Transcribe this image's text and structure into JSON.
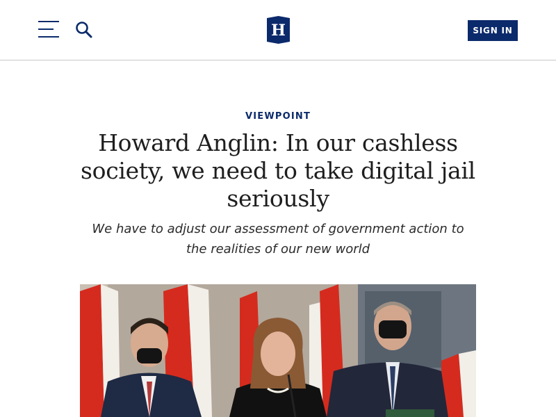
{
  "header": {
    "menu_icon": "hamburger-menu-icon",
    "search_icon": "search-icon",
    "logo_letter": "H",
    "logo_alt": "H",
    "signin_label": "SIGN IN"
  },
  "article": {
    "section": "VIEWPOINT",
    "headline": "Howard Anglin: In our cashless society, we need to take digital jail seriously",
    "deck": "We have to adjust our assessment of government action to the realities of our new world"
  },
  "colors": {
    "brand_navy": "#0b2a6b",
    "divider": "#c8c8c8",
    "flag_red": "#d52b1e"
  }
}
